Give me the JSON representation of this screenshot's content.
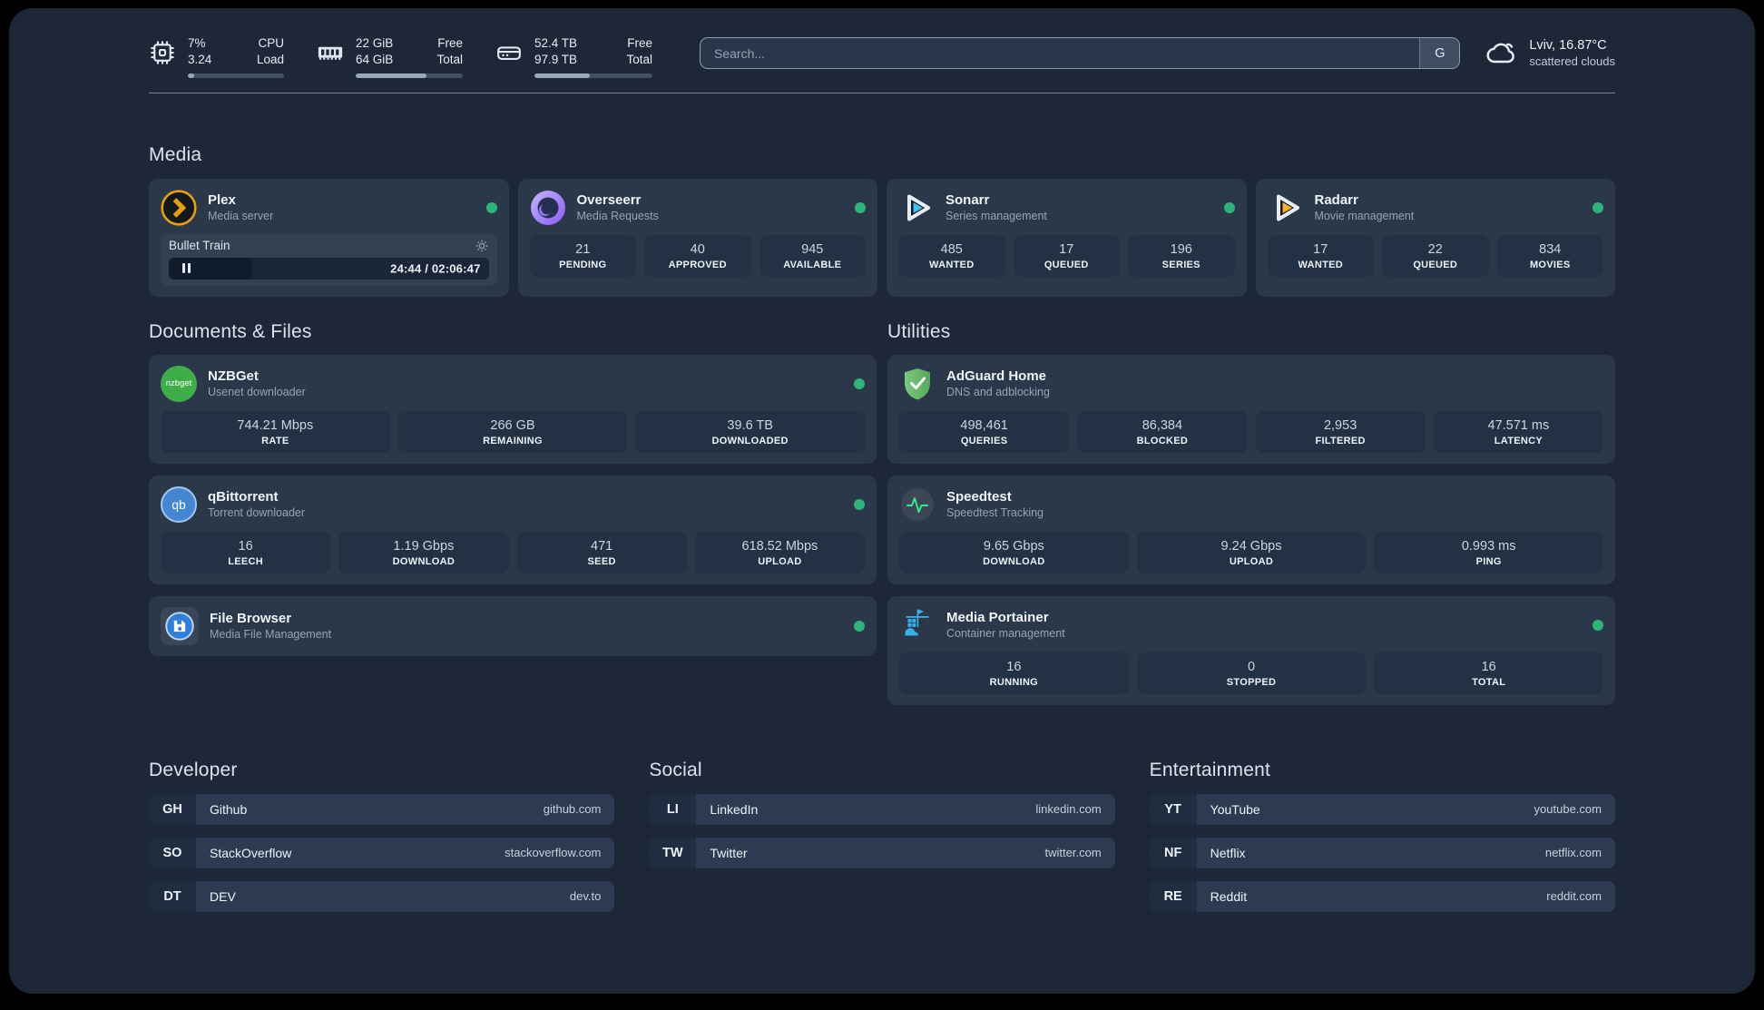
{
  "colors": {
    "status_online": "#2db47a",
    "plex_accent": "#e5a00d",
    "sonarr_accent": "#38c5f3",
    "radarr_accent": "#fdb22b",
    "portainer_accent": "#35b1e4"
  },
  "topbar": {
    "cpu": {
      "icon": "cpu-icon",
      "value_top": "7%",
      "value_bottom": "3.24",
      "label_top": "CPU",
      "label_bottom": "Load",
      "progress_pct": 7
    },
    "memory": {
      "icon": "memory-icon",
      "value_top": "22 GiB",
      "value_bottom": "64 GiB",
      "label_top": "Free",
      "label_bottom": "Total",
      "progress_pct": 66
    },
    "disk": {
      "icon": "disk-icon",
      "value_top": "52.4 TB",
      "value_bottom": "97.9 TB",
      "label_top": "Free",
      "label_bottom": "Total",
      "progress_pct": 47
    },
    "search": {
      "placeholder": "Search...",
      "engine_button": "G"
    },
    "weather": {
      "icon": "cloud-icon",
      "location": "Lviv, 16.87°C",
      "condition": "scattered clouds"
    }
  },
  "sections": {
    "media": "Media",
    "documents": "Documents & Files",
    "utilities": "Utilities"
  },
  "media": {
    "plex": {
      "name": "Plex",
      "description": "Media server",
      "online": true,
      "now_playing": {
        "title": "Bullet Train",
        "elapsed": "24:44",
        "duration": "02:06:47",
        "time_display": "24:44 / 02:06:47",
        "state": "paused",
        "progress_pct": 26
      }
    },
    "overseerr": {
      "name": "Overseerr",
      "description": "Media Requests",
      "online": true,
      "stats": [
        {
          "value": "21",
          "label": "PENDING"
        },
        {
          "value": "40",
          "label": "APPROVED"
        },
        {
          "value": "945",
          "label": "AVAILABLE"
        }
      ]
    },
    "sonarr": {
      "name": "Sonarr",
      "description": "Series management",
      "online": true,
      "stats": [
        {
          "value": "485",
          "label": "WANTED"
        },
        {
          "value": "17",
          "label": "QUEUED"
        },
        {
          "value": "196",
          "label": "SERIES"
        }
      ]
    },
    "radarr": {
      "name": "Radarr",
      "description": "Movie management",
      "online": true,
      "stats": [
        {
          "value": "17",
          "label": "WANTED"
        },
        {
          "value": "22",
          "label": "QUEUED"
        },
        {
          "value": "834",
          "label": "MOVIES"
        }
      ]
    }
  },
  "documents": {
    "nzbget": {
      "name": "NZBGet",
      "description": "Usenet downloader",
      "online": true,
      "badge": "nzbget",
      "stats": [
        {
          "value": "744.21 Mbps",
          "label": "RATE"
        },
        {
          "value": "266 GB",
          "label": "REMAINING"
        },
        {
          "value": "39.6 TB",
          "label": "DOWNLOADED"
        }
      ]
    },
    "qbittorrent": {
      "name": "qBittorrent",
      "description": "Torrent downloader",
      "online": true,
      "badge": "qb",
      "stats": [
        {
          "value": "16",
          "label": "LEECH"
        },
        {
          "value": "1.19 Gbps",
          "label": "DOWNLOAD"
        },
        {
          "value": "471",
          "label": "SEED"
        },
        {
          "value": "618.52 Mbps",
          "label": "UPLOAD"
        }
      ]
    },
    "filebrowser": {
      "name": "File Browser",
      "description": "Media File Management",
      "online": true
    }
  },
  "utilities": {
    "adguard": {
      "name": "AdGuard Home",
      "description": "DNS and adblocking",
      "stats": [
        {
          "value": "498,461",
          "label": "QUERIES"
        },
        {
          "value": "86,384",
          "label": "BLOCKED"
        },
        {
          "value": "2,953",
          "label": "FILTERED"
        },
        {
          "value": "47.571 ms",
          "label": "LATENCY"
        }
      ]
    },
    "speedtest": {
      "name": "Speedtest",
      "description": "Speedtest Tracking",
      "stats": [
        {
          "value": "9.65 Gbps",
          "label": "DOWNLOAD"
        },
        {
          "value": "9.24 Gbps",
          "label": "UPLOAD"
        },
        {
          "value": "0.993 ms",
          "label": "PING"
        }
      ]
    },
    "portainer": {
      "name": "Media Portainer",
      "description": "Container management",
      "online": true,
      "stats": [
        {
          "value": "16",
          "label": "RUNNING"
        },
        {
          "value": "0",
          "label": "STOPPED"
        },
        {
          "value": "16",
          "label": "TOTAL"
        }
      ]
    }
  },
  "bookmarks": [
    {
      "title": "Developer",
      "items": [
        {
          "abbr": "GH",
          "name": "Github",
          "domain": "github.com"
        },
        {
          "abbr": "SO",
          "name": "StackOverflow",
          "domain": "stackoverflow.com"
        },
        {
          "abbr": "DT",
          "name": "DEV",
          "domain": "dev.to"
        }
      ]
    },
    {
      "title": "Social",
      "items": [
        {
          "abbr": "LI",
          "name": "LinkedIn",
          "domain": "linkedin.com"
        },
        {
          "abbr": "TW",
          "name": "Twitter",
          "domain": "twitter.com"
        }
      ]
    },
    {
      "title": "Entertainment",
      "items": [
        {
          "abbr": "YT",
          "name": "YouTube",
          "domain": "youtube.com"
        },
        {
          "abbr": "NF",
          "name": "Netflix",
          "domain": "netflix.com"
        },
        {
          "abbr": "RE",
          "name": "Reddit",
          "domain": "reddit.com"
        }
      ]
    }
  ]
}
